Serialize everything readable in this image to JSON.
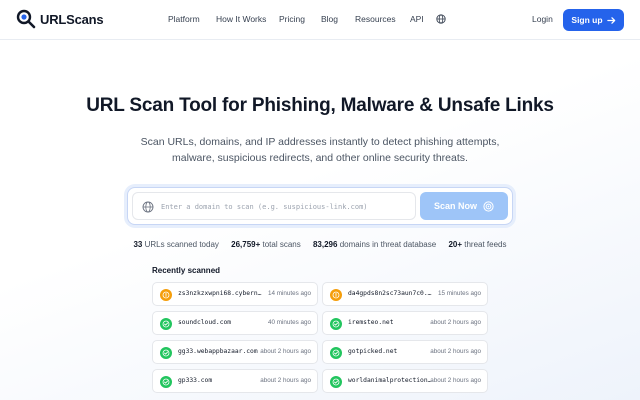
{
  "brand": {
    "name": "URLScans",
    "accent": "#2563eb"
  },
  "nav": {
    "items": [
      "Platform",
      "How It Works",
      "Pricing",
      "Blog",
      "Resources",
      "API"
    ],
    "login": "Login",
    "signup": "Sign up"
  },
  "hero": {
    "title": "URL Scan Tool for Phishing, Malware & Unsafe Links",
    "subtitle": "Scan URLs, domains, and IP addresses instantly to detect phishing attempts, malware, suspicious redirects, and other online security threats."
  },
  "search": {
    "placeholder": "Enter a domain to scan (e.g. suspicious-link.com)",
    "button": "Scan Now"
  },
  "stats": [
    {
      "value": "33",
      "label": "URLs scanned today"
    },
    {
      "value": "26,759+",
      "label": "total scans"
    },
    {
      "value": "83,296",
      "label": "domains in threat database"
    },
    {
      "value": "20+",
      "label": "threat feeds"
    }
  ],
  "recent": {
    "title": "Recently scanned",
    "status_colors": {
      "warning": "#f59e0b",
      "safe": "#22c55e"
    },
    "items": [
      {
        "url": "zs3nzkzxwpni68.cybernov...",
        "time": "14 minutes ago",
        "status": "warning"
      },
      {
        "url": "da4gpds8n2sc73aun7c0.cy...",
        "time": "15 minutes ago",
        "status": "warning"
      },
      {
        "url": "soundcloud.com",
        "time": "40 minutes ago",
        "status": "safe"
      },
      {
        "url": "iremsteo.net",
        "time": "about 2 hours ago",
        "status": "safe"
      },
      {
        "url": "gg33.webappbazaar.com",
        "time": "about 2 hours ago",
        "status": "safe"
      },
      {
        "url": "gotpicked.net",
        "time": "about 2 hours ago",
        "status": "safe"
      },
      {
        "url": "gp333.com",
        "time": "about 2 hours ago",
        "status": "safe"
      },
      {
        "url": "worldanimalprotection...",
        "time": "about 2 hours ago",
        "status": "safe"
      }
    ]
  }
}
